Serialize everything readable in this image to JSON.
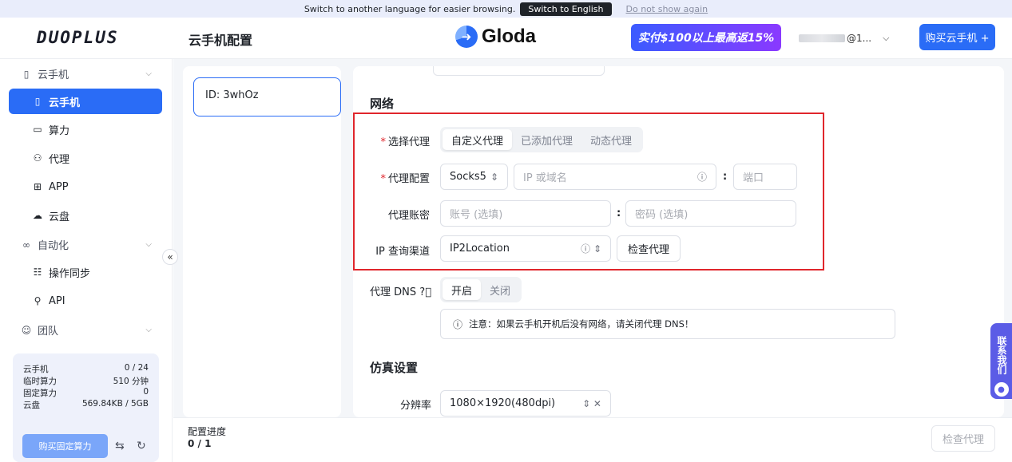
{
  "banner": {
    "message": "Switch to another language for easier browsing.",
    "switch_label": "Switch to English",
    "dismiss_label": "Do not show again"
  },
  "header": {
    "logo": "DUOPLUS",
    "page_title": "云手机配置",
    "brand_name": "Gloda",
    "promo_text": "实付$100以上最高返15%",
    "account_suffix": "@1...",
    "buy_button": "购买云手机 +"
  },
  "sidebar": {
    "groups": {
      "cloud": "云手机",
      "automation": "自动化",
      "team": "团队"
    },
    "items": {
      "cloud_phone": "云手机",
      "compute": "算力",
      "proxy": "代理",
      "app": "APP",
      "disk": "云盘",
      "sync": "操作同步",
      "api": "API"
    },
    "quota": [
      {
        "label": "云手机",
        "value": "0 / 24"
      },
      {
        "label": "临时算力",
        "value": "510 分钟"
      },
      {
        "label": "固定算力",
        "value": "0"
      },
      {
        "label": "云盘",
        "value": "569.84KB / 5GB"
      }
    ],
    "buy_fixed": "购买固定算力"
  },
  "device": {
    "id_label": "ID: 3whOz"
  },
  "form": {
    "network_title": "网络",
    "proxy_select_label": "选择代理",
    "proxy_modes": [
      "自定义代理",
      "已添加代理",
      "动态代理"
    ],
    "proxy_config_label": "代理配置",
    "protocol_value": "Socks5",
    "host_placeholder": "IP 或域名",
    "port_placeholder": "端口",
    "account_label": "代理账密",
    "username_placeholder": "账号 (选填)",
    "password_placeholder": "密码 (选填)",
    "ip_channel_label": "IP 查询渠道",
    "ip_channel_value": "IP2Location",
    "check_proxy": "检查代理",
    "dns_label": "代理 DNS",
    "dns_options": [
      "开启",
      "关闭"
    ],
    "notice": "注意：如果云手机开机后没有网络，请关闭代理 DNS！",
    "emulation_title": "仿真设置",
    "resolution_label": "分辨率",
    "resolution_value": "1080×1920(480dpi)"
  },
  "footer": {
    "progress_label": "配置进度",
    "progress_value": "0 / 1",
    "check_proxy": "检查代理"
  },
  "contact": {
    "label": "联系我们"
  },
  "colors": {
    "accent": "#2a6cf6",
    "highlight": "#e0262c",
    "contact": "#5b5ce6"
  }
}
